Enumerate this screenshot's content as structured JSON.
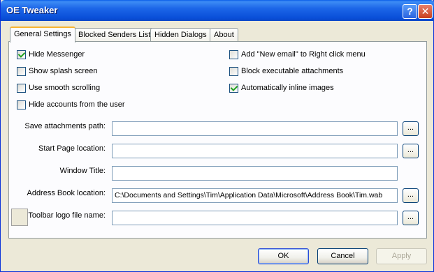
{
  "window": {
    "title": "OE Tweaker"
  },
  "titlebar": {
    "help_glyph": "?",
    "close_glyph": "✕"
  },
  "tabs": [
    {
      "label": "General Settings",
      "active": true
    },
    {
      "label": "Blocked Senders List",
      "active": false
    },
    {
      "label": "Hidden Dialogs",
      "active": false
    },
    {
      "label": "About",
      "active": false
    }
  ],
  "options": {
    "hide_messenger": {
      "label": "Hide Messenger",
      "checked": true
    },
    "show_splash": {
      "label": "Show splash screen",
      "checked": false
    },
    "smooth_scroll": {
      "label": "Use smooth scrolling",
      "checked": false
    },
    "hide_accounts": {
      "label": "Hide accounts from the user",
      "checked": false
    },
    "new_email_menu": {
      "label": "Add \"New email\" to Right click menu",
      "checked": false
    },
    "block_exec": {
      "label": "Block executable attachments",
      "checked": false
    },
    "inline_images": {
      "label": "Automatically inline images",
      "checked": true
    }
  },
  "fields": {
    "save_attachments": {
      "label": "Save attachments path:",
      "value": ""
    },
    "start_page": {
      "label": "Start Page location:",
      "value": ""
    },
    "window_title": {
      "label": "Window Title:",
      "value": ""
    },
    "address_book": {
      "label": "Address Book location:",
      "value": "C:\\Documents and Settings\\Tim\\Application Data\\Microsoft\\Address Book\\Tim.wab"
    },
    "toolbar_logo": {
      "label": "Toolbar logo file name:",
      "value": ""
    }
  },
  "browse_label": "...",
  "buttons": {
    "ok": "OK",
    "cancel": "Cancel",
    "apply": "Apply"
  }
}
